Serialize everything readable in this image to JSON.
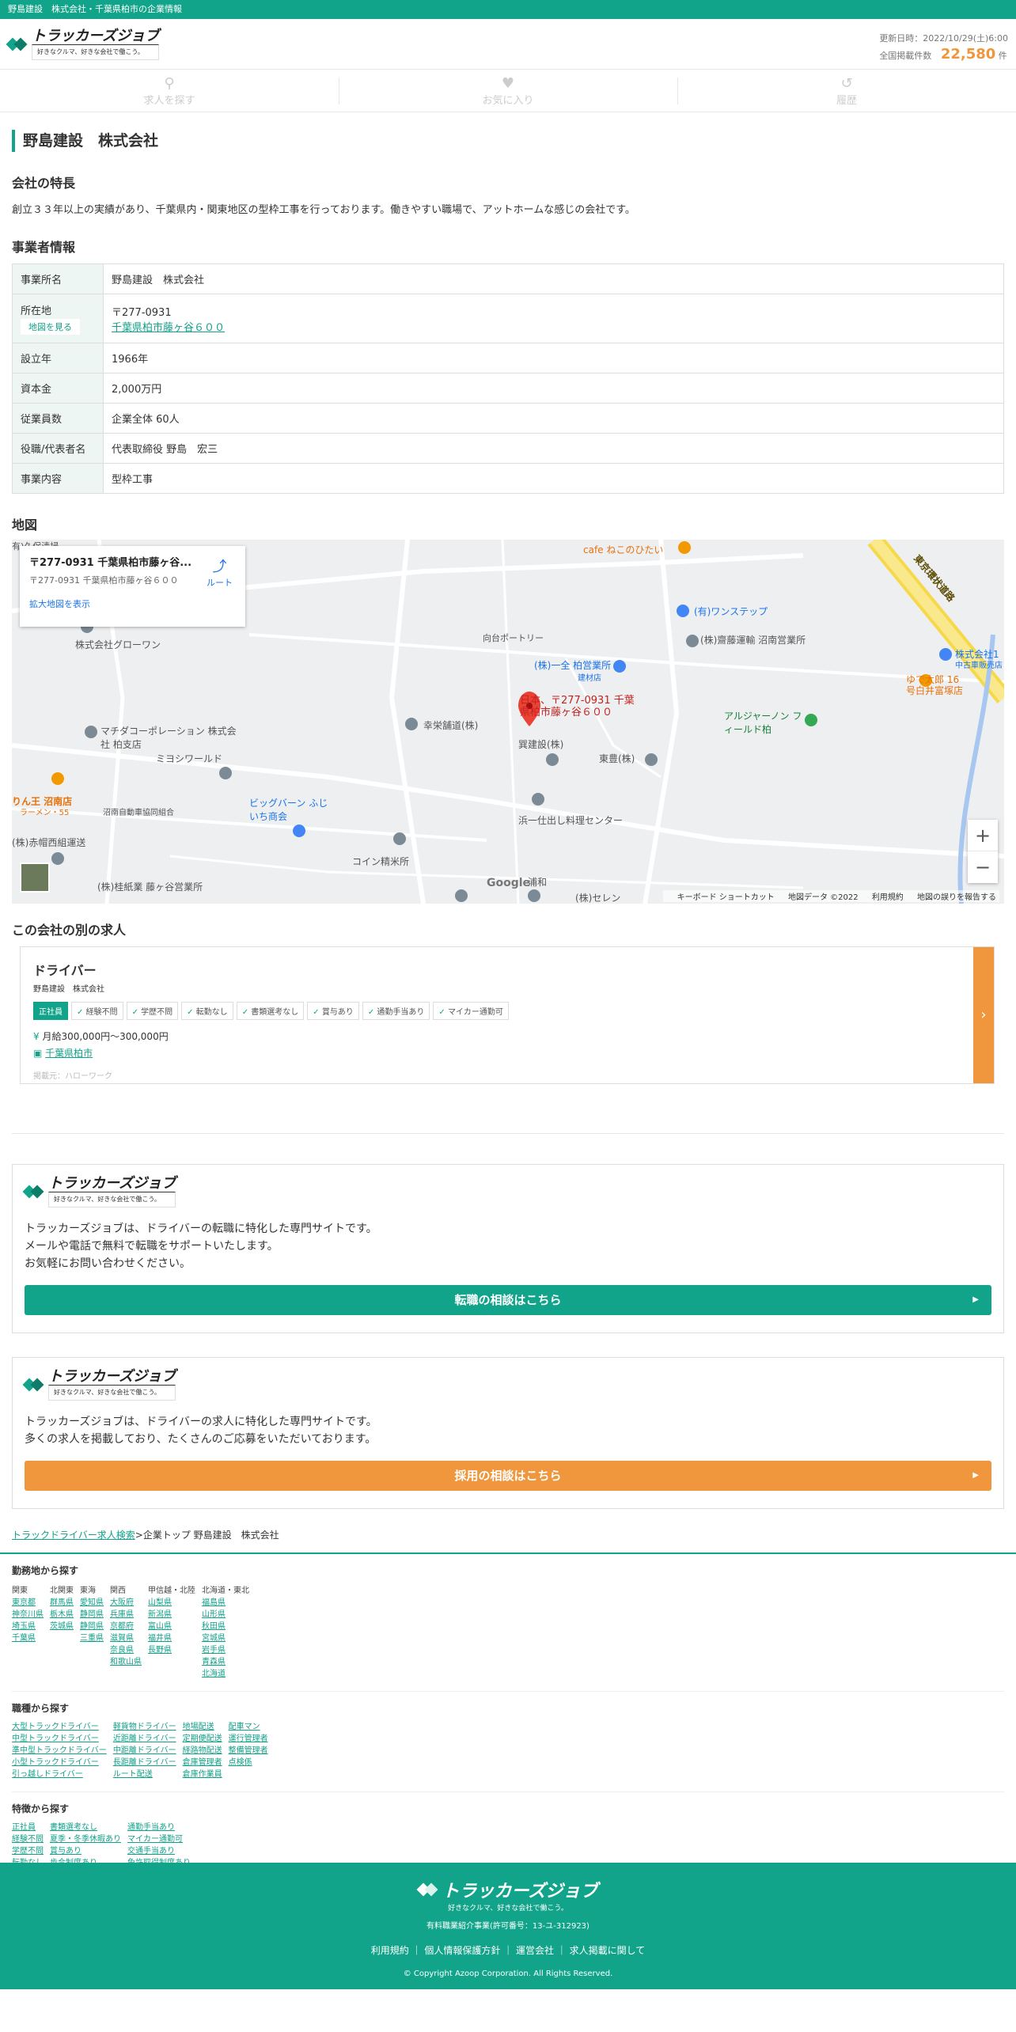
{
  "topbar": {
    "text": "野島建設　株式会社・千葉県柏市の企業情報"
  },
  "header": {
    "logo_name": "トラッカーズジョブ",
    "logo_tagline": "好きなクルマ、好きな会社で働こう。",
    "updated": "更新日時：2022/10/29(土)6:00",
    "count_label": "全国掲載件数",
    "count_value": "22,580",
    "count_unit": "件"
  },
  "nav": [
    {
      "label": "求人を探す",
      "icon": "search-icon"
    },
    {
      "label": "お気に入り",
      "icon": "heart-icon"
    },
    {
      "label": "履歴",
      "icon": "history-icon"
    }
  ],
  "page_title": "野島建設　株式会社",
  "feature": {
    "heading": "会社の特長",
    "text": "創立３３年以上の実績があり、千葉県内・関東地区の型枠工事を行っております。働きやすい職場で、アットホームな感じの会社です。"
  },
  "company_info": {
    "heading": "事業者情報",
    "name_label": "事業所名",
    "name_value": "野島建設　株式会社",
    "addr_label": "所在地",
    "addr_map_btn": "地図を見る",
    "addr_zip": "〒277-0931",
    "addr_link": "千葉県柏市藤ヶ谷６００",
    "founded_label": "設立年",
    "founded_value": "1966年",
    "capital_label": "資本金",
    "capital_value": "2,000万円",
    "staff_label": "従業員数",
    "staff_value": "企業全体 60人",
    "rep_label": "役職/代表者名",
    "rep_value": "代表取締役 野島　宏三",
    "biz_label": "事業内容",
    "biz_value": "型枠工事"
  },
  "map": {
    "heading": "地図",
    "card_title": "〒277-0931 千葉県柏市藤ヶ谷...",
    "card_sub": "〒277-0931 千葉県柏市藤ヶ谷６００",
    "card_link": "拡大地図を表示",
    "route": "ルート",
    "pin_label": "日本、〒277-0931 千葉県柏市藤ヶ谷６００",
    "labels": [
      "cafe ねこのひたい",
      "(有)ワンステップ",
      "東京環状道路",
      "株式会社グローワン",
      "向台ポートリー",
      "(株)一全 柏営業所",
      "建材店",
      "(株)齋藤運輸 沼南営業所",
      "株式会社1",
      "中古車販売店",
      "ゆで太郎 16",
      "号白井富塚店",
      "マチダコーポレーション 株式会社 柏支店",
      "幸栄舗道(株)",
      "アルジャーノン フィールド柏",
      "ミヨシワールド",
      "巽建設(株)",
      "東豊(株)",
      "りん王 沼南店",
      "ラーメン・55",
      "沼南自動車協同組合",
      "ビッグバーン ふじいち商会",
      "浜一仕出し料理センター",
      "(株)赤帽西組運送",
      "コイン精米所",
      "(株)桂紙業 藤ヶ谷営業所",
      "(株)セレン",
      "浦和",
      "有)久保清掃"
    ],
    "google": "Google",
    "attrib": [
      "キーボード ショートカット",
      "地図データ ©2022",
      "利用規約",
      "地図の誤りを報告する"
    ]
  },
  "other_jobs": {
    "heading": "この会社の別の求人",
    "title": "ドライバー",
    "company": "野島建設　株式会社",
    "tags": [
      "正社員",
      "経験不問",
      "学歴不問",
      "転勤なし",
      "書類選考なし",
      "賞与あり",
      "通勤手当あり",
      "マイカー通勤可"
    ],
    "salary": "月給300,000円〜300,000円",
    "location": "千葉県柏市",
    "source": "掲載元：ハローワーク"
  },
  "promo1": {
    "text1": "トラッカーズジョブは、ドライバーの転職に特化した専門サイトです。",
    "text2": "メールや電話で無料で転職をサポートいたします。",
    "text3": "お気軽にお問い合わせください。",
    "button": "転職の相談はこちら"
  },
  "promo2": {
    "text1": "トラッカーズジョブは、ドライバーの求人に特化した専門サイトです。",
    "text2": "多くの求人を掲載しており、たくさんのご応募をいただいております。",
    "button": "採用の相談はこちら"
  },
  "breadcrumb": {
    "link": "トラックドライバー求人検索",
    "sep": ">",
    "rest": "企業トップ 野島建設　株式会社"
  },
  "search_area": {
    "heading": "勤務地から探す",
    "cols": [
      {
        "head": "関東",
        "items": [
          "東京都",
          "神奈川県",
          "埼玉県",
          "千葉県"
        ]
      },
      {
        "head": "北関東",
        "items": [
          "群馬県",
          "栃木県",
          "茨城県"
        ]
      },
      {
        "head": "東海",
        "items": [
          "愛知県",
          "静岡県",
          "静岡県",
          "三重県"
        ]
      },
      {
        "head": "関西",
        "items": [
          "大阪府",
          "兵庫県",
          "京都府",
          "滋賀県",
          "奈良県",
          "和歌山県"
        ]
      },
      {
        "head": "甲信越・北陸",
        "items": [
          "山梨県",
          "新潟県",
          "富山県",
          "福井県",
          "長野県"
        ]
      },
      {
        "head": "北海道・東北",
        "items": [
          "福島県",
          "山形県",
          "秋田県",
          "宮城県",
          "岩手県",
          "青森県",
          "北海道"
        ]
      }
    ]
  },
  "search_job": {
    "heading": "職種から探す",
    "cols": [
      {
        "items": [
          "大型トラックドライバー",
          "中型トラックドライバー",
          "準中型トラックドライバー",
          "小型トラックドライバー",
          "引っ越しドライバー"
        ]
      },
      {
        "items": [
          "軽貨物ドライバー",
          "近距離ドライバー",
          "中距離ドライバー",
          "長距離ドライバー",
          "ルート配送"
        ]
      },
      {
        "items": [
          "地場配送",
          "定期便配送",
          "経路物配送",
          "倉庫管理者",
          "倉庫作業員"
        ]
      },
      {
        "items": [
          "配車マン",
          "運行管理者",
          "整備管理者",
          "点検係"
        ]
      }
    ]
  },
  "search_feature": {
    "heading": "特徴から探す",
    "cols": [
      {
        "items": [
          "正社員",
          "経験不問",
          "学歴不問",
          "転勤なし"
        ]
      },
      {
        "items": [
          "書類選考なし",
          "夏季・冬季休暇あり",
          "賞与あり",
          "歩合制度あり"
        ]
      },
      {
        "items": [
          "通勤手当あり",
          "マイカー通勤可",
          "交通手当あり",
          "免許取得制度あり"
        ]
      }
    ]
  },
  "footer": {
    "logo_name": "トラッカーズジョブ",
    "tagline": "好きなクルマ、好きな会社で働こう。",
    "license": "有料職業紹介事業(許可番号：13-ユ-312923)",
    "links": [
      "利用規約",
      "個人情報保護方針",
      "運営会社",
      "求人掲載に関して"
    ],
    "copyright": "© Copyright Azoop Corporation. All Rights Reserved."
  }
}
